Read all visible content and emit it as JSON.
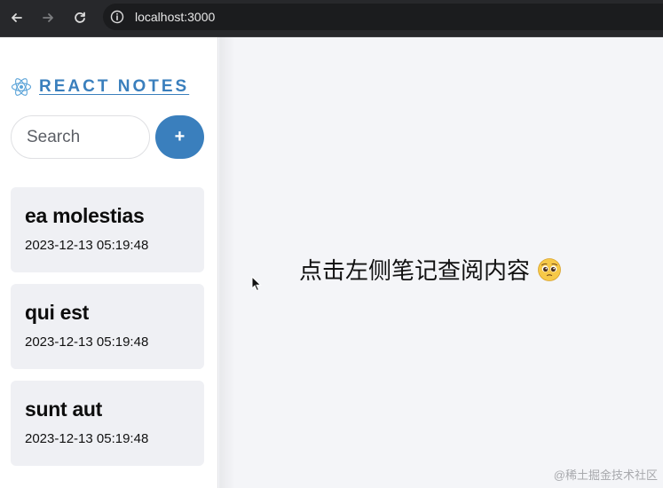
{
  "browser": {
    "url": "localhost:3000",
    "icons": [
      "back-arrow-icon",
      "forward-arrow-icon",
      "reload-icon",
      "info-icon"
    ]
  },
  "sidebar": {
    "brand": "REACT NOTES",
    "brand_icon": "react-atom-icon",
    "search_placeholder": "Search",
    "add_label": "+",
    "accent": "#3a7fbd",
    "notes": [
      {
        "title": "ea molestias",
        "date": "2023-12-13 05:19:48"
      },
      {
        "title": "qui est",
        "date": "2023-12-13 05:19:48"
      },
      {
        "title": "sunt aut",
        "date": "2023-12-13 05:19:48"
      }
    ]
  },
  "main": {
    "empty_message": "点击左侧笔记查阅内容",
    "emoji_icon": "pleading-face-icon",
    "watermark": "@稀土掘金技术社区"
  }
}
